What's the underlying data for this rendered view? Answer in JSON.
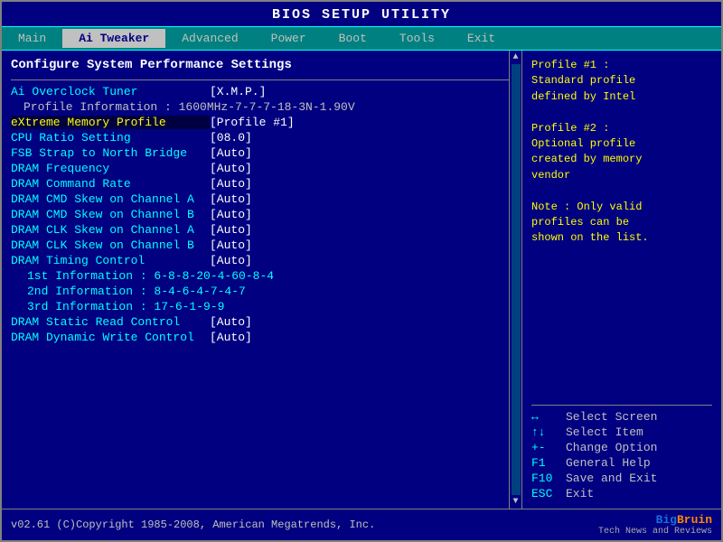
{
  "title": "BIOS SETUP UTILITY",
  "menu": {
    "items": [
      {
        "label": "Main",
        "active": false
      },
      {
        "label": "Ai Tweaker",
        "active": true
      },
      {
        "label": "Advanced",
        "active": false
      },
      {
        "label": "Power",
        "active": false
      },
      {
        "label": "Boot",
        "active": false
      },
      {
        "label": "Tools",
        "active": false
      },
      {
        "label": "Exit",
        "active": false
      }
    ]
  },
  "left": {
    "section_title": "Configure System Performance Settings",
    "rows": [
      {
        "label": "Ai Overclock Tuner",
        "value": "[X.M.P.]",
        "type": "normal"
      },
      {
        "label": "Profile Information : 1600MHz-7-7-7-18-3N-1.90V",
        "value": "",
        "type": "info"
      },
      {
        "label": "eXtreme Memory Profile",
        "value": "[Profile #1]",
        "type": "highlight"
      },
      {
        "label": "CPU Ratio Setting",
        "value": "[08.0]",
        "type": "normal"
      },
      {
        "label": "FSB Strap to North Bridge",
        "value": "[Auto]",
        "type": "normal"
      },
      {
        "label": "DRAM Frequency",
        "value": "[Auto]",
        "type": "normal"
      },
      {
        "label": "DRAM Command Rate",
        "value": "[Auto]",
        "type": "normal"
      },
      {
        "label": "DRAM CMD Skew on Channel A",
        "value": "[Auto]",
        "type": "normal"
      },
      {
        "label": "DRAM CMD Skew on Channel B",
        "value": "[Auto]",
        "type": "normal"
      },
      {
        "label": "DRAM CLK Skew on Channel A",
        "value": "[Auto]",
        "type": "normal"
      },
      {
        "label": "DRAM CLK Skew on Channel B",
        "value": "[Auto]",
        "type": "normal"
      },
      {
        "label": "DRAM Timing Control",
        "value": "[Auto]",
        "type": "normal"
      },
      {
        "label": "1st Information : 6-8-8-20-4-60-8-4",
        "value": "",
        "type": "indent"
      },
      {
        "label": "2nd Information : 8-4-6-4-7-4-7",
        "value": "",
        "type": "indent"
      },
      {
        "label": "3rd Information : 17-6-1-9-9",
        "value": "",
        "type": "indent"
      },
      {
        "label": "DRAM Static Read Control",
        "value": "[Auto]",
        "type": "normal"
      },
      {
        "label": "DRAM Dynamic Write Control",
        "value": "[Auto]",
        "type": "normal"
      }
    ]
  },
  "right": {
    "help_lines": [
      "Profile #1 :",
      "Standard profile",
      "defined by Intel",
      "",
      "Profile #2 :",
      "Optional profile",
      "created by memory",
      "vendor",
      "",
      "Note : Only valid",
      "profiles can be",
      "shown on the list."
    ],
    "keys": [
      {
        "key": "↔",
        "desc": "Select Screen"
      },
      {
        "key": "↑↓",
        "desc": "Select Item"
      },
      {
        "key": "+-",
        "desc": "Change Option"
      },
      {
        "key": "F1",
        "desc": "General Help"
      },
      {
        "key": "F10",
        "desc": "Save and Exit"
      },
      {
        "key": "ESC",
        "desc": "Exit"
      }
    ]
  },
  "footer": {
    "version": "v02.61 (C)Copyright 1985-2008, American Megatrends, Inc.",
    "brand": "Big Bruin",
    "brand_sub": "Tech News and Reviews"
  }
}
